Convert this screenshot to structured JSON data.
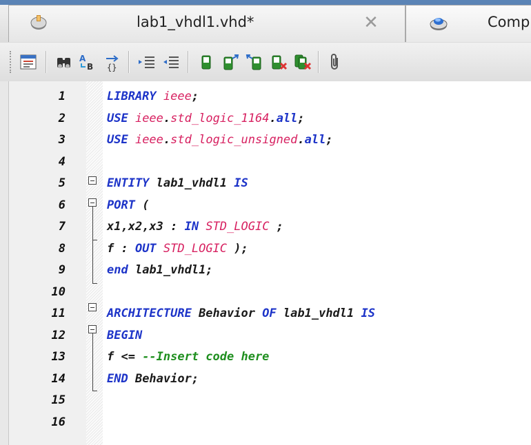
{
  "tabs": {
    "active": {
      "title": "lab1_vhdl1.vhd*",
      "icon": "vhdl-file-icon"
    },
    "second": {
      "title": "Comp",
      "icon": "compilation-report-icon"
    },
    "close_icon": "close-icon"
  },
  "toolbar": {
    "buttons": [
      "open-file-icon",
      "find-icon",
      "find-replace-icon",
      "insert-template-icon",
      "increase-indent-icon",
      "decrease-indent-icon",
      "bookmark-icon",
      "next-bookmark-icon",
      "previous-bookmark-icon",
      "delete-bookmark-icon",
      "clear-bookmarks-icon",
      "attach-icon"
    ]
  },
  "editor": {
    "line_numbers": [
      "1",
      "2",
      "3",
      "4",
      "5",
      "6",
      "7",
      "8",
      "9",
      "10",
      "11",
      "12",
      "13",
      "14",
      "15",
      "16"
    ],
    "lines": [
      [
        [
          "kw",
          "LIBRARY "
        ],
        [
          "lib",
          "ieee"
        ],
        [
          "pn",
          ";"
        ]
      ],
      [
        [
          "kw",
          "USE "
        ],
        [
          "lib",
          "ieee"
        ],
        [
          "pn",
          "."
        ],
        [
          "lib",
          "std_logic_1164"
        ],
        [
          "pn",
          "."
        ],
        [
          "kw",
          "all"
        ],
        [
          "pn",
          ";"
        ]
      ],
      [
        [
          "kw",
          "USE "
        ],
        [
          "lib",
          "ieee"
        ],
        [
          "pn",
          "."
        ],
        [
          "lib",
          "std_logic_unsigned"
        ],
        [
          "pn",
          "."
        ],
        [
          "kw",
          "all"
        ],
        [
          "pn",
          ";"
        ]
      ],
      [],
      [
        [
          "kw",
          "ENTITY "
        ],
        [
          "id",
          "lab1_vhdl1 "
        ],
        [
          "kw",
          "IS"
        ]
      ],
      [
        [
          "kw",
          "PORT "
        ],
        [
          "pn",
          "("
        ]
      ],
      [
        [
          "id",
          "x1,x2,x3 : "
        ],
        [
          "kw",
          "IN "
        ],
        [
          "ty",
          "STD_LOGIC"
        ],
        [
          "pn",
          " ;"
        ]
      ],
      [
        [
          "id",
          "f : "
        ],
        [
          "kw",
          "OUT "
        ],
        [
          "ty",
          "STD_LOGIC"
        ],
        [
          "pn",
          " );"
        ]
      ],
      [
        [
          "kw",
          "end "
        ],
        [
          "id",
          "lab1_vhdl1;"
        ]
      ],
      [],
      [
        [
          "kw",
          "ARCHITECTURE "
        ],
        [
          "id",
          "Behavior "
        ],
        [
          "kw",
          "OF "
        ],
        [
          "id",
          "lab1_vhdl1 "
        ],
        [
          "kw",
          "IS"
        ]
      ],
      [
        [
          "kw",
          "BEGIN"
        ]
      ],
      [
        [
          "id",
          "f <= "
        ],
        [
          "cm",
          "--Insert code here"
        ]
      ],
      [
        [
          "kw",
          "END "
        ],
        [
          "id",
          "Behavior;"
        ]
      ],
      [],
      []
    ],
    "colors": {
      "keyword": "#1c33c8",
      "library": "#d72060",
      "comment": "#1f8f1f",
      "identifier": "#1a1a1a"
    }
  }
}
